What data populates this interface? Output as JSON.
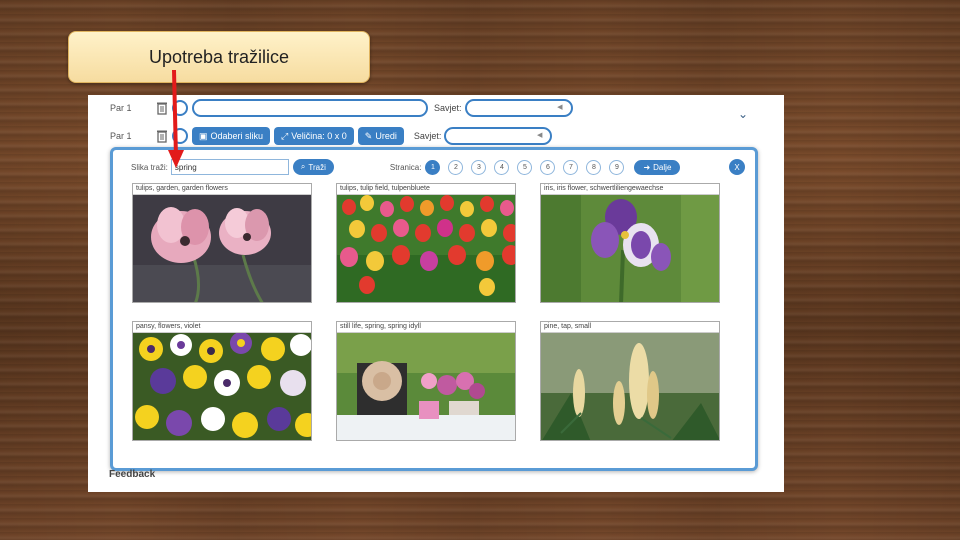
{
  "callout": {
    "text": "Upotreba tražilice"
  },
  "rows": [
    {
      "label": "Par 1",
      "savjet_label": "Savjet:"
    },
    {
      "label": "Par 1",
      "savjet_label": "Savjet:"
    }
  ],
  "row2_buttons": {
    "odaberi": "Odaberi sliku",
    "velicina": "Veličina: 0 x 0",
    "uredi": "Uredi"
  },
  "modal": {
    "search_label": "Slika traži:",
    "search_value": "spring",
    "search_button": "Traži",
    "page_label": "Stranica:",
    "pages": [
      "1",
      "2",
      "3",
      "4",
      "5",
      "6",
      "7",
      "8",
      "9"
    ],
    "active_page": "1",
    "next_button": "Dalje",
    "close_button": "X"
  },
  "images": [
    {
      "caption": "tulips, garden, garden flowers"
    },
    {
      "caption": "tulips, tulip field, tulpenbluete"
    },
    {
      "caption": "iris, iris flower, schwertliliengewaechse"
    },
    {
      "caption": "pansy, flowers, violet"
    },
    {
      "caption": "still life, spring, spring idyll"
    },
    {
      "caption": "pine, tap, small"
    }
  ],
  "footer": {
    "feedback": "Feedback"
  },
  "colors": {
    "accent": "#3a7fc4",
    "arrow": "#e21b1b"
  }
}
